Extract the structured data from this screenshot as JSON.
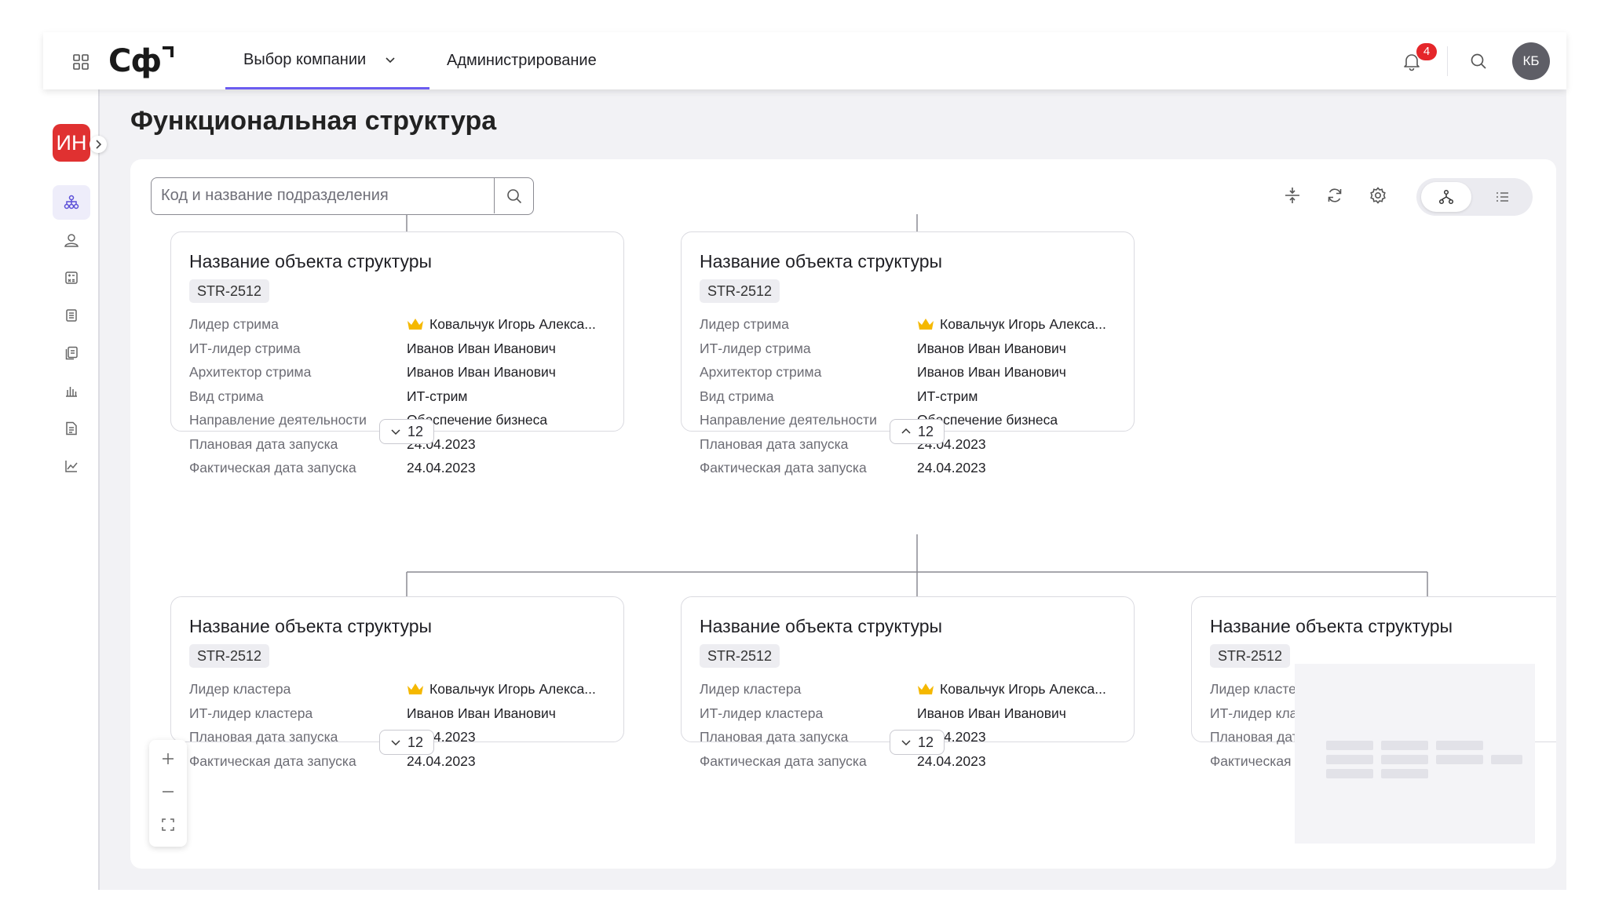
{
  "header": {
    "logo": "Сф",
    "nav_company": "Выбор компании",
    "nav_admin": "Администрирование",
    "notifications_count": "4",
    "user_initials": "КБ"
  },
  "sidebar": {
    "org_initials": "ИН",
    "items": [
      "structure-icon",
      "people-icon",
      "calculator-icon",
      "list-icon",
      "documents-icon",
      "bar-chart-icon",
      "report-icon",
      "trend-icon"
    ]
  },
  "page": {
    "title": "Функциональная структура",
    "search_placeholder": "Код и название подразделения"
  },
  "toolbar": {
    "tools": [
      "collapse-icon",
      "refresh-icon",
      "settings-icon"
    ],
    "view_modes": [
      "tree-view-icon",
      "list-view-icon"
    ],
    "active_view": "tree"
  },
  "cards": [
    {
      "title": "Название объекта структуры",
      "code": "STR-2512",
      "rows": [
        {
          "k": "Лидер стрима",
          "v": "Ковальчук Игорь Алекса...",
          "crown": true
        },
        {
          "k": "ИТ-лидер стрима",
          "v": "Иванов Иван Иванович"
        },
        {
          "k": "Архитектор стрима",
          "v": "Иванов Иван Иванович"
        },
        {
          "k": "Вид стрима",
          "v": "ИТ-стрим"
        },
        {
          "k": "Направление деятельности",
          "v": "Обеспечение бизнеса"
        },
        {
          "k": "Плановая дата запуска",
          "v": "24.04.2023"
        },
        {
          "k": "Фактическая дата запуска",
          "v": "24.04.2023"
        }
      ],
      "children_count": "12",
      "expanded": false
    },
    {
      "title": "Название объекта структуры",
      "code": "STR-2512",
      "rows": [
        {
          "k": "Лидер стрима",
          "v": "Ковальчук Игорь Алекса...",
          "crown": true
        },
        {
          "k": "ИТ-лидер стрима",
          "v": "Иванов Иван Иванович"
        },
        {
          "k": "Архитектор стрима",
          "v": "Иванов Иван Иванович"
        },
        {
          "k": "Вид стрима",
          "v": "ИТ-стрим"
        },
        {
          "k": "Направление деятельности",
          "v": "Обеспечение бизнеса"
        },
        {
          "k": "Плановая дата запуска",
          "v": "24.04.2023"
        },
        {
          "k": "Фактическая дата запуска",
          "v": "24.04.2023"
        }
      ],
      "children_count": "12",
      "expanded": true
    },
    {
      "title": "Название объекта структуры",
      "code": "STR-2512",
      "rows": [
        {
          "k": "Лидер кластера",
          "v": "Ковальчук Игорь Алекса...",
          "crown": true
        },
        {
          "k": "ИТ-лидер кластера",
          "v": "Иванов Иван Иванович"
        },
        {
          "k": "Плановая дата запуска",
          "v": "24.04.2023"
        },
        {
          "k": "Фактическая дата запуска",
          "v": "24.04.2023"
        }
      ],
      "children_count": "12",
      "expanded": false
    },
    {
      "title": "Название объекта структуры",
      "code": "STR-2512",
      "rows": [
        {
          "k": "Лидер кластера",
          "v": "Ковальчук Игорь Алекса...",
          "crown": true
        },
        {
          "k": "ИТ-лидер кластера",
          "v": "Иванов Иван Иванович"
        },
        {
          "k": "Плановая дата запуска",
          "v": "24.04.2023"
        },
        {
          "k": "Фактическая дата запуска",
          "v": "24.04.2023"
        }
      ],
      "children_count": "12",
      "expanded": false
    },
    {
      "title": "Название объекта структуры",
      "code": "STR-2512",
      "rows": [
        {
          "k": "Лидер кластера",
          "v": ""
        },
        {
          "k": "ИТ-лидер кластера",
          "v": ""
        },
        {
          "k": "Плановая дата запуска",
          "v": ""
        },
        {
          "k": "Фактическая дата запуска",
          "v": ""
        }
      ],
      "children_count": "",
      "expanded": false
    }
  ],
  "zoom_controls": [
    "zoom-in-icon",
    "zoom-out-icon",
    "fit-screen-icon"
  ],
  "colors": {
    "accent": "#6b5cf0",
    "badge_red": "#e5262a",
    "org_red": "#e03131",
    "crown": "#f5b800"
  }
}
